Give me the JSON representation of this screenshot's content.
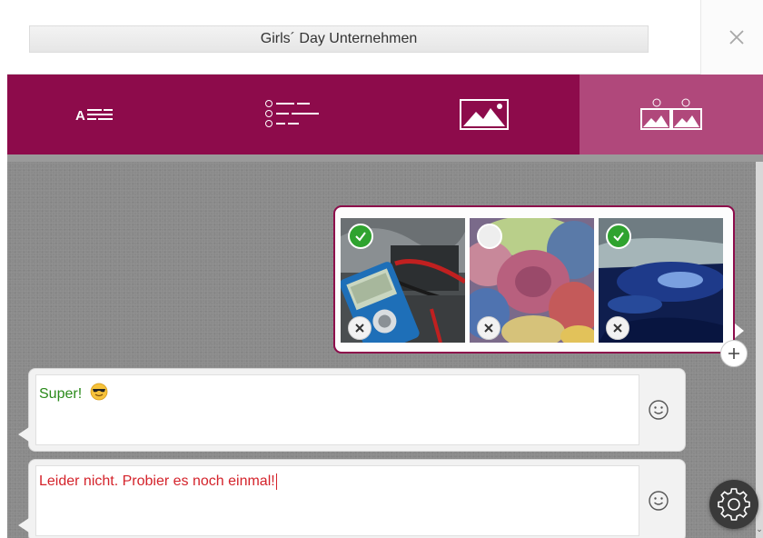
{
  "header": {
    "title": "Girls´ Day Unternehmen",
    "close_icon": "close-icon"
  },
  "tabs": [
    {
      "name": "text-answer",
      "icon": "text-lines-icon",
      "active": false
    },
    {
      "name": "multiple-choice",
      "icon": "abc-list-icon",
      "active": false
    },
    {
      "name": "image",
      "icon": "image-icon",
      "active": false
    },
    {
      "name": "image-choice",
      "icon": "image-ab-icon",
      "active": true
    }
  ],
  "image_choices": [
    {
      "subject": "multimeter",
      "selected": true
    },
    {
      "subject": "towels",
      "selected": false
    },
    {
      "subject": "car-paint",
      "selected": true
    }
  ],
  "feedback": {
    "correct_text": "Super!",
    "correct_emoji": "smiling-face-with-sunglasses",
    "incorrect_text": "Leider nicht. Probier es noch einmal!"
  },
  "colors": {
    "brand": "#8d0b4b",
    "active_tab": "#b0487b",
    "correct": "#2a8a1a",
    "incorrect": "#d4232b",
    "check": "#2fa32f"
  }
}
